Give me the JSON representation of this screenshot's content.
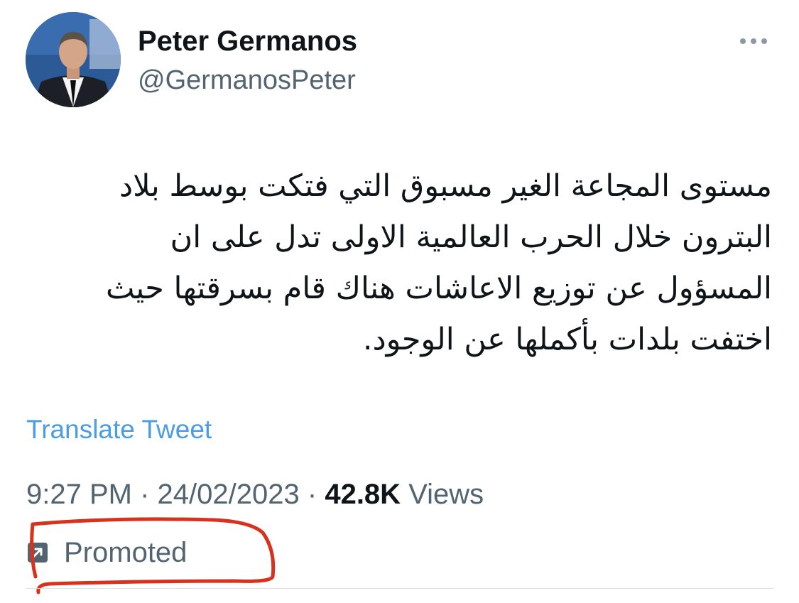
{
  "tweet": {
    "author": {
      "display_name": "Peter Germanos",
      "handle": "@GermanosPeter",
      "avatar_icon": "profile-photo"
    },
    "more_icon": "ellipsis-horizontal-icon",
    "text_lines": [
      "مستوى المجاعة الغير مسبوق التي فتكت بوسط بلاد",
      "البترون خلال الحرب العالمية الاولى تدل على ان",
      "المسؤول عن توزيع الاعاشات هناك قام بسرقتها حيث",
      "اختفت بلدات بأكملها عن الوجود."
    ],
    "translate_label": "Translate Tweet",
    "time": "9:27 PM",
    "separator": "·",
    "date": "24/02/2023",
    "views_count": "42.8K",
    "views_label": "Views",
    "promoted_icon": "promoted-arrow-icon",
    "promoted_label": "Promoted"
  },
  "colors": {
    "text_primary": "#0f1419",
    "text_secondary": "#536471",
    "link": "#4a9de0",
    "annotation_red": "#d8321f",
    "divider": "#dcdfe3"
  }
}
